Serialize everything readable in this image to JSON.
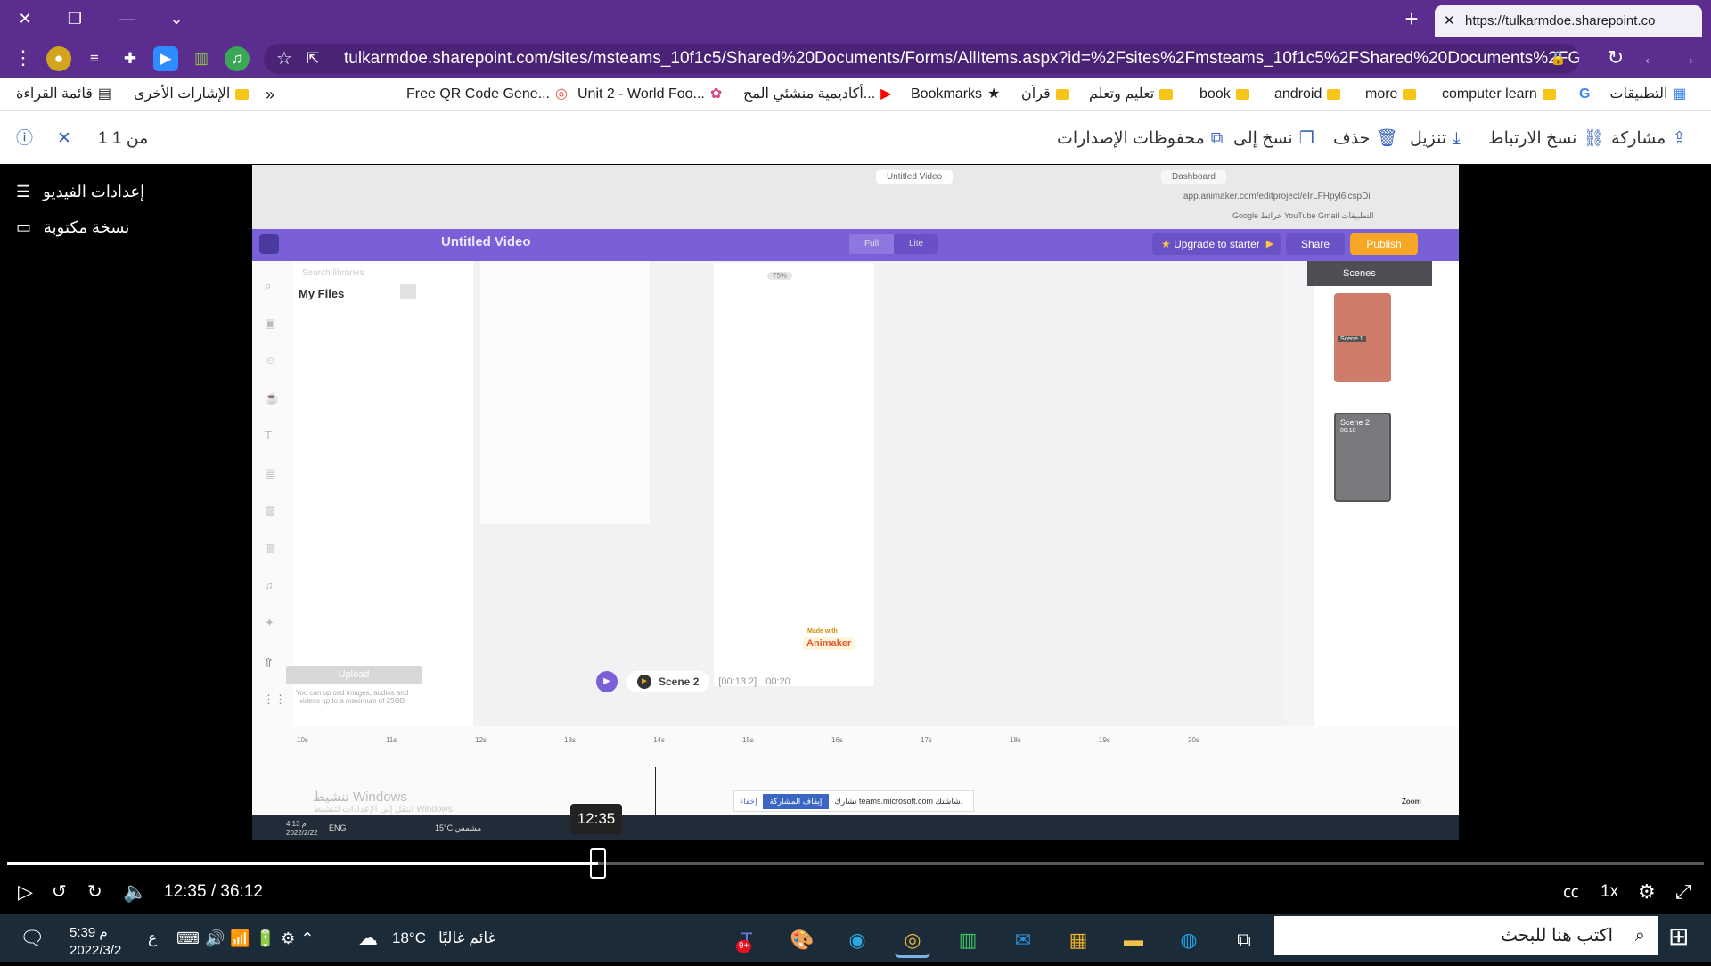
{
  "browser": {
    "tab_url": "https://tulkarmdoe.sharepoint.co",
    "address": "tulkarmdoe.sharepoint.com/sites/msteams_10f1c5/Shared%20Documents/Forms/AllItems.aspx?id=%2Fsites%2Fmsteams_10f1c5%2FShared%20Documents%2FGeneral%2FRe...",
    "bookmarks_overflow": "»",
    "bookmarks": [
      "قائمة القراءة",
      "الإشارات الأخرى",
      "Free QR Code Gene...",
      "Unit 2 - World Foo...",
      "أكاديمية منشئي المح...",
      "Bookmarks",
      "قرآن",
      "تعليم وتعلم",
      "book",
      "android",
      "more",
      "computer learn",
      "التطبيقات"
    ]
  },
  "commandbar": {
    "share": "مشاركة",
    "copy_link": "نسخ الارتباط",
    "download": "تنزيل",
    "delete": "حذف",
    "copy_to": "نسخ إلى",
    "version_history": "محفوظات الإصدارات",
    "page_count": "1 من 1"
  },
  "side_menu": {
    "video_settings": "إعدادات الفيديو",
    "transcript": "نسخة مكتوبة"
  },
  "embedded": {
    "inner_url": "app.animaker.com/editproject/eIrLFHpyl6lcspDi",
    "inner_tabs": [
      "Untitled Video",
      "Dashboard"
    ],
    "inner_bookmarks": "Google خرائط   YouTube   Gmail   التطبيقات",
    "app_title": "Untitled Video",
    "mode_full": "Full",
    "mode_lite": "Lite",
    "zoom_badge": "75%",
    "upgrade": "Upgrade to starter",
    "share": "Share",
    "publish": "Publish",
    "search_placeholder": "Search libraries",
    "my_files": "My Files",
    "upload_btn": "Upload",
    "upload_note": "You can upload images, audios and videos up to a maximum of 25GB",
    "scenes_title": "Scenes",
    "scene1": "Scene 1",
    "scene2": "Scene 2",
    "scene2_time": "00:10",
    "made_with": "Made with",
    "brand": "Animaker",
    "current_scene": "Scene 2",
    "scene_time": "[00:13.2]",
    "scene_total": "00:20",
    "ticks": [
      "10s",
      "11s",
      "12s",
      "13s",
      "14s",
      "15s",
      "16s",
      "17s",
      "18s",
      "19s",
      "20s"
    ],
    "windows_watermark": "تنشيط Windows",
    "windows_watermark2": "انتقل إلى الإعدادات لتنشيط Windows",
    "share_notice": "تشارك teams.microsoft.com شاشتك.",
    "stop_share": "إيقاف المشاركة",
    "hide": "إخفاء",
    "zoom": "Zoom",
    "inner_clock": "4:13 م",
    "inner_date": "2022/2/22",
    "inner_lang": "ENG",
    "inner_weather": "15°C مشمس"
  },
  "player": {
    "tooltip_time": "12:35",
    "current": "12:35",
    "separator": "/",
    "duration": "36:12",
    "progress": 0.348,
    "speed": "1x"
  },
  "taskbar": {
    "search_placeholder": "اكتب هنا للبحث",
    "weather": "غائم غالبًا",
    "temp": "18°C",
    "time": "5:39 م",
    "date": "2022/3/2",
    "lang": "ع",
    "teams_badge": "9+"
  }
}
